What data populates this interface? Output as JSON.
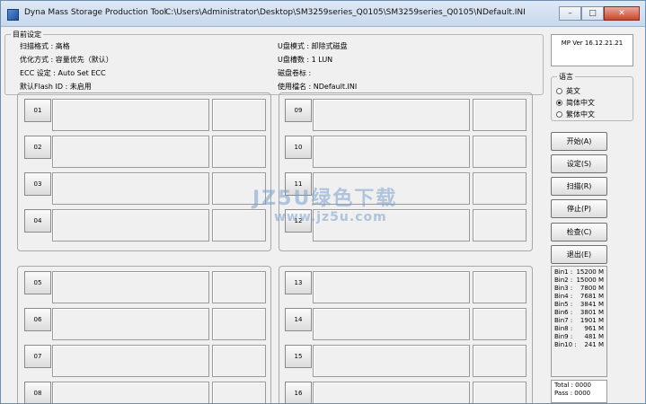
{
  "window": {
    "app_title": "Dyna Mass Storage Production Tool",
    "path": "C:\\Users\\Administrator\\Desktop\\SM3259series_Q0105\\SM3259series_Q0105\\NDefault.INI",
    "min": "–",
    "max": "□",
    "close": "✕"
  },
  "settings": {
    "legend": "目前设定",
    "scan_level": "扫描格式 : 高格",
    "optimize": "优化方式 : 容量优先（默认）",
    "ecc": "ECC 设定 : Auto Set ECC",
    "flash_id": "默认Flash ID : 未启用",
    "udisk_mode": "U盘模式 : 卸除式磁盘",
    "udisk_lun": "U盘槽数 : 1 LUN",
    "disk_label": "磁盘卷标 :",
    "ini_name": "使用檔名 : NDefault.INI"
  },
  "slots": [
    "01",
    "02",
    "03",
    "04",
    "05",
    "06",
    "07",
    "08",
    "09",
    "10",
    "11",
    "12",
    "13",
    "14",
    "15",
    "16"
  ],
  "version": "MP Ver 16.12.21.21",
  "language": {
    "legend": "语言",
    "options": [
      "英文",
      "简体中文",
      "繁体中文"
    ],
    "selected": "简体中文"
  },
  "actions": {
    "start": "开始(A)",
    "setup": "设定(S)",
    "scan": "扫描(R)",
    "stop": "停止(P)",
    "check": "检查(C)",
    "exit": "退出(E)"
  },
  "bins": [
    {
      "label": "Bin1 :",
      "value": "15200 M"
    },
    {
      "label": "Bin2 :",
      "value": "15000 M"
    },
    {
      "label": "Bin3 :",
      "value": "7800 M"
    },
    {
      "label": "Bin4 :",
      "value": "7681 M"
    },
    {
      "label": "Bin5 :",
      "value": "3841 M"
    },
    {
      "label": "Bin6 :",
      "value": "3801 M"
    },
    {
      "label": "Bin7 :",
      "value": "1901 M"
    },
    {
      "label": "Bin8 :",
      "value": "961 M"
    },
    {
      "label": "Bin9 :",
      "value": "481 M"
    },
    {
      "label": "Bin10 :",
      "value": "241 M"
    }
  ],
  "totals": {
    "total": "Total : 0000",
    "pass": "Pass : 0000"
  },
  "watermark": {
    "main": "JZ5U绿色下载",
    "sub": "www.jz5u.com"
  }
}
